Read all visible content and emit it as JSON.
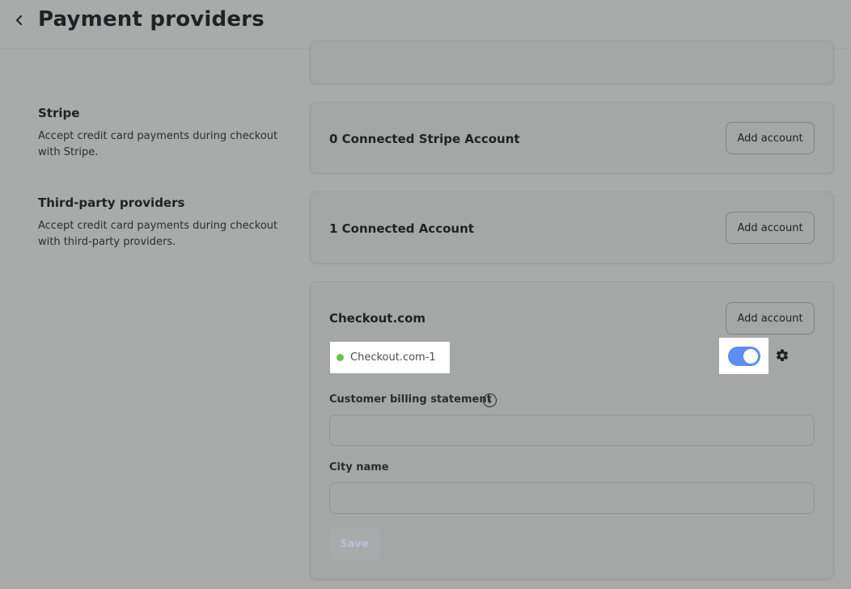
{
  "header": {
    "back_icon": "chevron-left-icon",
    "title": "Payment providers"
  },
  "sections": {
    "stripe": {
      "title": "Stripe",
      "description": "Accept credit card payments during checkout with Stripe.",
      "card_heading": "0 Connected Stripe Account",
      "add_label": "Add account"
    },
    "third_party": {
      "title": "Third-party providers",
      "description": "Accept credit card payments during checkout with third-party providers.",
      "card_heading": "1 Connected Account",
      "add_label": "Add account"
    }
  },
  "checkout": {
    "heading": "Checkout.com",
    "add_label": "Add account",
    "account": {
      "name": "Checkout.com-1",
      "status_color": "#6cc24a",
      "enabled": true
    },
    "gear_icon": "gear-icon",
    "fields": {
      "billing_label": "Customer billing statement",
      "billing_value": "",
      "city_label": "City name",
      "city_value": ""
    },
    "save_label": "Save"
  },
  "colors": {
    "toggle_on": "#5b8def"
  }
}
